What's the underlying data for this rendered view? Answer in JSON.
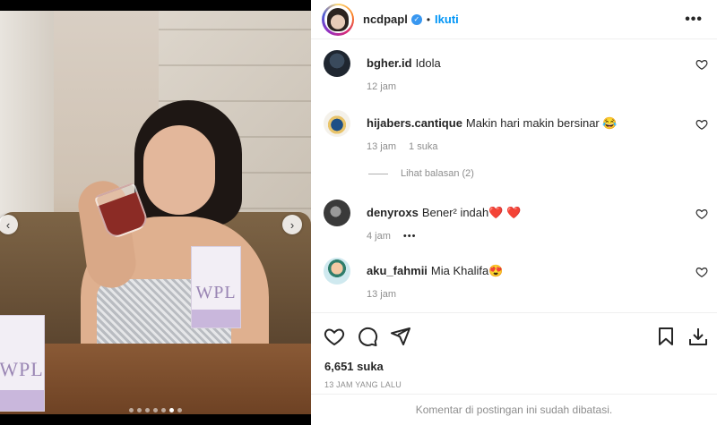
{
  "post": {
    "username": "ncdpapl",
    "separator": "•",
    "follow_label": "Ikuti",
    "more_icon": "•••",
    "product_box_label": "WPL",
    "carousel": {
      "total_slides": 7,
      "active_slide": 6
    }
  },
  "comments": [
    {
      "user": "bgher.id",
      "text": "Idola",
      "time": "12 jam",
      "likes": ""
    },
    {
      "user": "hijabers.cantique",
      "text": "Makin hari makin bersinar 😂",
      "time": "13 jam",
      "likes": "1 suka"
    },
    {
      "user": "denyroxs",
      "text": "Bener² indah❤️ ❤️",
      "time": "4 jam",
      "likes": "",
      "options": "•••"
    },
    {
      "user": "aku_fahmii",
      "text": "Mia Khalifa😍",
      "time": "13 jam",
      "likes": ""
    }
  ],
  "replies": {
    "label": "Lihat balasan (2)"
  },
  "footer": {
    "likes_count": "6,651 suka",
    "posted": "13 JAM YANG LALU",
    "comments_closed": "Komentar di postingan ini sudah dibatasi."
  },
  "colors": {
    "link_blue": "#0095f6",
    "verified_blue": "#3897f0",
    "muted_gray": "#8e8e8e"
  },
  "icons": {
    "prev": "chevron-left-icon",
    "next": "chevron-right-icon",
    "like": "heart-icon",
    "comment": "comment-icon",
    "share": "paper-plane-icon",
    "save": "bookmark-icon",
    "download": "download-icon"
  }
}
